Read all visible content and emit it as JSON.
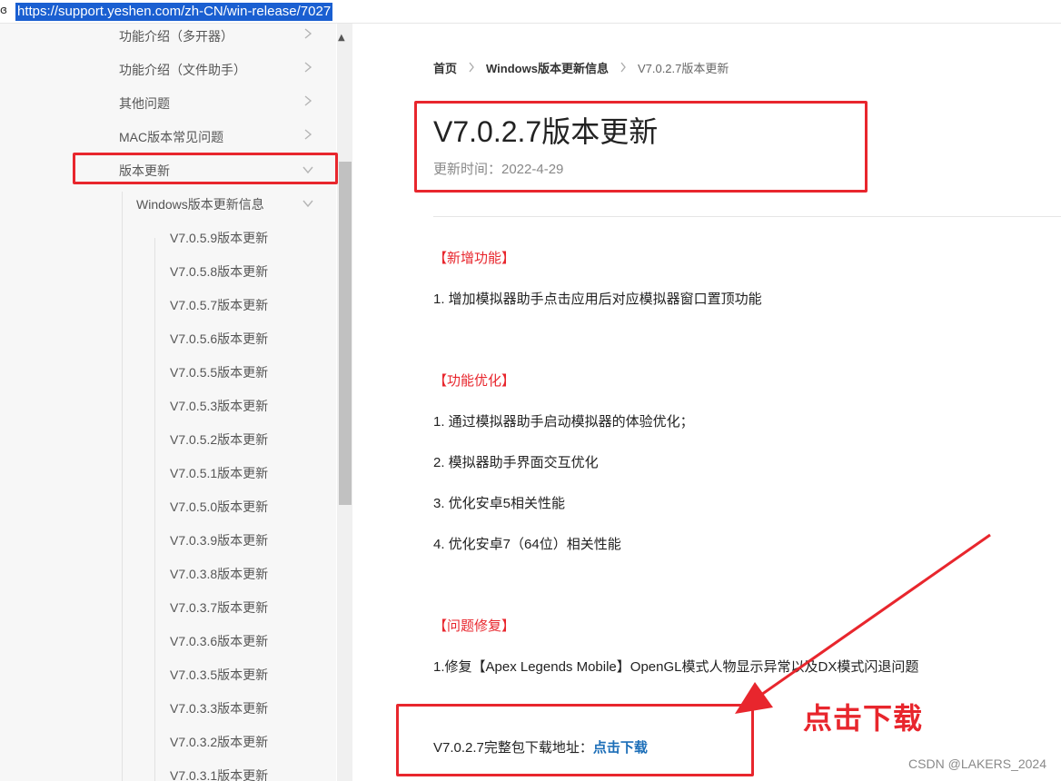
{
  "browser": {
    "url": "https://support.yeshen.com/zh-CN/win-release/7027",
    "lock_icon": "site-info-icon"
  },
  "sidebar": {
    "items": [
      {
        "label": "功能介绍（多开器）",
        "state": "collapsed"
      },
      {
        "label": "功能介绍（文件助手）",
        "state": "collapsed"
      },
      {
        "label": "其他问题",
        "state": "collapsed"
      },
      {
        "label": "MAC版本常见问题",
        "state": "collapsed"
      },
      {
        "label": "版本更新",
        "state": "expanded"
      }
    ],
    "sub_group": {
      "label": "Windows版本更新信息",
      "state": "expanded"
    },
    "releases": [
      "V7.0.5.9版本更新",
      "V7.0.5.8版本更新",
      "V7.0.5.7版本更新",
      "V7.0.5.6版本更新",
      "V7.0.5.5版本更新",
      "V7.0.5.3版本更新",
      "V7.0.5.2版本更新",
      "V7.0.5.1版本更新",
      "V7.0.5.0版本更新",
      "V7.0.3.9版本更新",
      "V7.0.3.8版本更新",
      "V7.0.3.7版本更新",
      "V7.0.3.6版本更新",
      "V7.0.3.5版本更新",
      "V7.0.3.3版本更新",
      "V7.0.3.2版本更新",
      "V7.0.3.1版本更新"
    ]
  },
  "breadcrumb": {
    "home": "首页",
    "section": "Windows版本更新信息",
    "current": "V7.0.2.7版本更新"
  },
  "article": {
    "title": "V7.0.2.7版本更新",
    "updated": "更新时间：2022-4-29",
    "sections": [
      {
        "heading": "【新增功能】",
        "items": [
          "1. 增加模拟器助手点击应用后对应模拟器窗口置顶功能"
        ]
      },
      {
        "heading": "【功能优化】",
        "items": [
          "1. 通过模拟器助手启动模拟器的体验优化；",
          "2. 模拟器助手界面交互优化",
          "3. 优化安卓5相关性能",
          "4. 优化安卓7（64位）相关性能"
        ]
      },
      {
        "heading": "【问题修复】",
        "items": [
          "1.修复【Apex Legends Mobile】OpenGL模式人物显示异常以及DX模式闪退问题"
        ]
      }
    ],
    "download_prefix": "V7.0.2.7完整包下载地址：",
    "download_link": "点击下载"
  },
  "annotation": {
    "callout": "点击下载",
    "color": "#e8262d"
  },
  "watermark": "CSDN @LAKERS_2024",
  "colors": {
    "accent_red": "#e8262d",
    "link_blue": "#1c6eb8",
    "url_highlight": "#1a5fd1",
    "sidebar_bg": "#f7f7f7"
  }
}
